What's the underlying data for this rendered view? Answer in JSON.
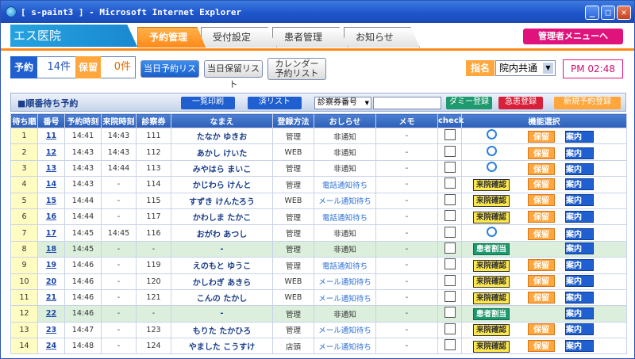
{
  "window": {
    "title": "[ s-paint3 ] - Microsoft Internet Explorer"
  },
  "header": {
    "clinic": "エス医院",
    "admin_button": "管理者メニューへ"
  },
  "tabs": [
    {
      "label": "予約管理"
    },
    {
      "label": "受付設定"
    },
    {
      "label": "患者管理"
    },
    {
      "label": "お知らせ"
    }
  ],
  "status": {
    "reservation_label": "予約",
    "reservation_value": "14件",
    "hold_label": "保留",
    "hold_value": "0件"
  },
  "toolbar": {
    "today_list": "当日予約リスト",
    "today_hold": "当日保留リスト",
    "calendar_line1": "カレンダー",
    "calendar_line2": "予約リスト",
    "doctor_label": "指名",
    "doctor_select": "院内共通",
    "time": "PM 02:48"
  },
  "section": {
    "title": "■順番待ち予約",
    "print_all": "一覧印刷",
    "done_list": "済リスト",
    "card_select": "診察券番号",
    "dummy": "ダミー登録",
    "urgent": "急患登録",
    "new": "新規予約登録"
  },
  "columns": [
    "待ち順",
    "番号",
    "予約時刻",
    "来院時刻",
    "診察券",
    "なまえ",
    "登録方法",
    "おしらせ",
    "メモ",
    "check",
    "機能選択"
  ],
  "labels": {
    "hold": "保留",
    "guide": "案内",
    "arrival": "来院確認",
    "assign": "患者割当"
  },
  "rows": [
    {
      "order": "1",
      "no": "11",
      "rtime": "14:41",
      "vtime": "14:43",
      "card": "111",
      "name": "たなか ゆきお",
      "method": "管理",
      "notice": "非通知",
      "memo": "-",
      "state": "ring"
    },
    {
      "order": "2",
      "no": "12",
      "rtime": "14:43",
      "vtime": "14:43",
      "card": "112",
      "name": "あかし けいた",
      "method": "WEB",
      "notice": "非通知",
      "memo": "-",
      "state": "ring"
    },
    {
      "order": "3",
      "no": "13",
      "rtime": "14:43",
      "vtime": "14:44",
      "card": "113",
      "name": "みやはら まいこ",
      "method": "管理",
      "notice": "非通知",
      "memo": "-",
      "state": "ring"
    },
    {
      "order": "4",
      "no": "14",
      "rtime": "14:43",
      "vtime": "-",
      "card": "114",
      "name": "かじわら けんと",
      "method": "管理",
      "notice": "電話通知待ち",
      "memo": "-",
      "state": "arrival"
    },
    {
      "order": "5",
      "no": "15",
      "rtime": "14:44",
      "vtime": "-",
      "card": "115",
      "name": "すずき けんたろう",
      "method": "WEB",
      "notice": "メール通知待ち",
      "memo": "-",
      "state": "arrival"
    },
    {
      "order": "6",
      "no": "16",
      "rtime": "14:44",
      "vtime": "-",
      "card": "117",
      "name": "かわしま たかこ",
      "method": "管理",
      "notice": "電話通知待ち",
      "memo": "-",
      "state": "arrival"
    },
    {
      "order": "7",
      "no": "17",
      "rtime": "14:45",
      "vtime": "14:45",
      "card": "116",
      "name": "おがわ あつし",
      "method": "管理",
      "notice": "非通知",
      "memo": "-",
      "state": "ring"
    },
    {
      "order": "8",
      "no": "18",
      "rtime": "14:45",
      "vtime": "-",
      "card": "-",
      "name": "-",
      "method": "管理",
      "notice": "非通知",
      "memo": "-",
      "state": "assign"
    },
    {
      "order": "9",
      "no": "19",
      "rtime": "14:46",
      "vtime": "-",
      "card": "119",
      "name": "えのもと ゆうこ",
      "method": "管理",
      "notice": "電話通知待ち",
      "memo": "-",
      "state": "arrival"
    },
    {
      "order": "10",
      "no": "20",
      "rtime": "14:46",
      "vtime": "-",
      "card": "120",
      "name": "かしわぎ あきら",
      "method": "WEB",
      "notice": "メール通知待ち",
      "memo": "-",
      "state": "arrival"
    },
    {
      "order": "11",
      "no": "21",
      "rtime": "14:46",
      "vtime": "-",
      "card": "121",
      "name": "こんの たかし",
      "method": "WEB",
      "notice": "メール通知待ち",
      "memo": "-",
      "state": "arrival"
    },
    {
      "order": "12",
      "no": "22",
      "rtime": "14:46",
      "vtime": "-",
      "card": "-",
      "name": "-",
      "method": "管理",
      "notice": "非通知",
      "memo": "-",
      "state": "assign"
    },
    {
      "order": "13",
      "no": "23",
      "rtime": "14:47",
      "vtime": "-",
      "card": "123",
      "name": "もりた たかひろ",
      "method": "管理",
      "notice": "メール通知待ち",
      "memo": "-",
      "state": "arrival"
    },
    {
      "order": "14",
      "no": "24",
      "rtime": "14:48",
      "vtime": "-",
      "card": "124",
      "name": "やました こうすけ",
      "method": "店頭",
      "notice": "メール通知待ち",
      "memo": "-",
      "state": "arrival"
    }
  ]
}
